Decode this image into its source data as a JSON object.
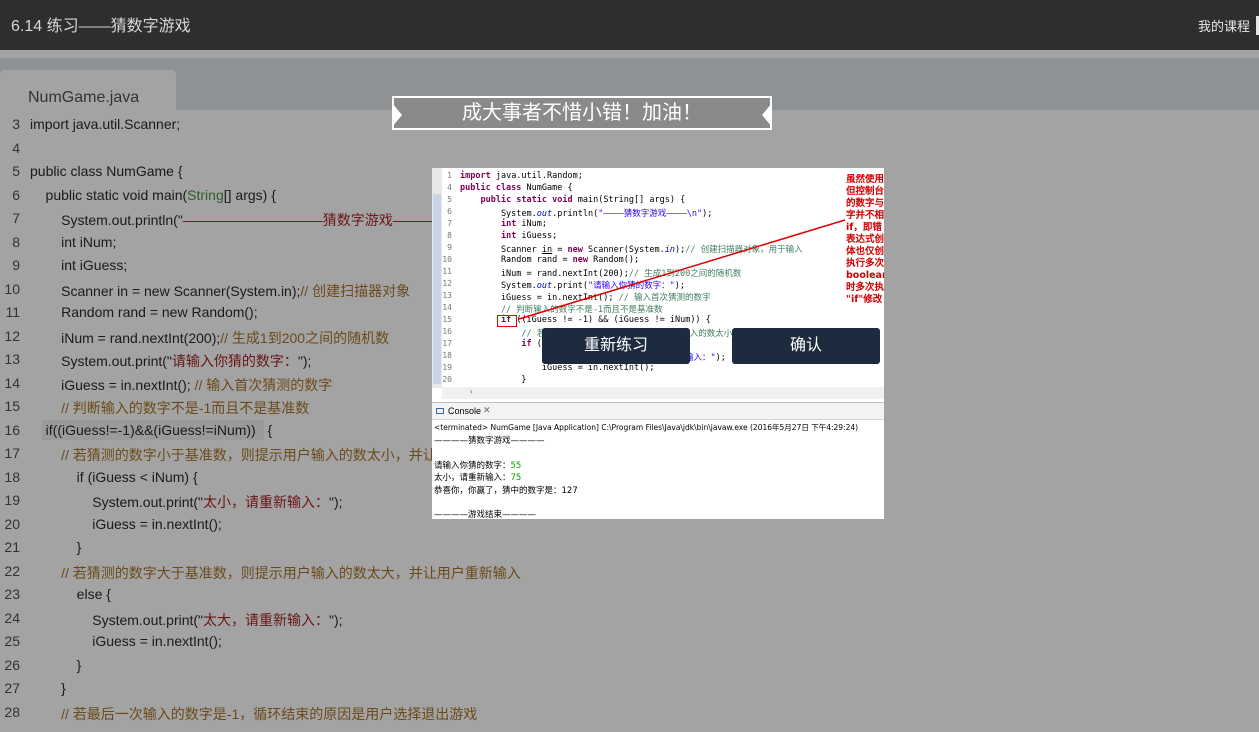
{
  "header": {
    "title": "6.14 练习——猜数字游戏",
    "my_courses": "我的课程"
  },
  "tab": {
    "label": "NumGame.java"
  },
  "editor": {
    "lines": [
      {
        "num": "3",
        "html": "import java.util.Scanner;"
      },
      {
        "num": "4",
        "html": ""
      },
      {
        "num": "5",
        "html": "public class NumGame {"
      },
      {
        "num": "6",
        "html": "    public static void main(<span class=\"ty\">String</span>[] args) {"
      },
      {
        "num": "7",
        "html": "        System.out.println(\"<span class=\"st\">——————————猜数字游戏——————————</span>"
      },
      {
        "num": "8",
        "html": "        int iNum;"
      },
      {
        "num": "9",
        "html": "        int iGuess;"
      },
      {
        "num": "10",
        "html": "        Scanner in = new Scanner(System.in);<span class=\"cm\">// 创建扫描器对象</span>"
      },
      {
        "num": "11",
        "html": "        Random rand = new Random();"
      },
      {
        "num": "12",
        "html": "        iNum = rand.nextInt(200);<span class=\"cm\">// 生成1到200之间的随机数</span>"
      },
      {
        "num": "13",
        "html": "        System.out.print(\"<span class=\"st\">请输入你猜的数字：</span>\");"
      },
      {
        "num": "14",
        "html": "        iGuess = in.nextInt(); <span class=\"cm\">// 输入首次猜测的数字</span>"
      },
      {
        "num": "15",
        "html": "        <span class=\"cm\">// 判断输入的数字不是-1而且不是基准数</span>"
      },
      {
        "num": "16",
        "html": "   <span class=\"hl\">if((iGuess!=-1)&&(iGuess!=iNum)) </span> {"
      },
      {
        "num": "17",
        "html": "        <span class=\"cm\">// 若猜测的数字小于基准数，则提示用户输入的数太小，并让用户重新输入</span>"
      },
      {
        "num": "18",
        "html": "            if (iGuess < iNum) {"
      },
      {
        "num": "19",
        "html": "                System.out.print(\"<span class=\"st\">太小，请重新输入：</span>\");"
      },
      {
        "num": "20",
        "html": "                iGuess = in.nextInt();"
      },
      {
        "num": "21",
        "html": "            }"
      },
      {
        "num": "22",
        "html": "        <span class=\"cm\">// 若猜测的数字大于基准数，则提示用户输入的数太大，并让用户重新输入</span>"
      },
      {
        "num": "23",
        "html": "            else {"
      },
      {
        "num": "24",
        "html": "                System.out.print(\"<span class=\"st\">太大，请重新输入：</span>\");"
      },
      {
        "num": "25",
        "html": "                iGuess = in.nextInt();"
      },
      {
        "num": "26",
        "html": "            }"
      },
      {
        "num": "27",
        "html": "        }"
      },
      {
        "num": "28",
        "html": "        <span class=\"cm\">// 若最后一次输入的数字是-1，循环结束的原因是用户选择退出游戏</span>"
      }
    ]
  },
  "banner": {
    "text": "成大事者不惜小错！加油！"
  },
  "popup": {
    "code_lines": [
      {
        "num": "1",
        "html": "<span class=\"kw\">import</span> java.util.Random;"
      },
      {
        "num": "4",
        "html": "<span class=\"kw\">public class</span> NumGame {"
      },
      {
        "num": "5",
        "html": "    <span class=\"kw\">public static void</span> main(String[] args) {"
      },
      {
        "num": "6",
        "html": "        System.<span class=\"sfld\">out</span>.println(<span class=\"sst\">\"————猜数字游戏————\\n\"</span>);"
      },
      {
        "num": "7",
        "html": "        <span class=\"kw\">int</span> iNum;"
      },
      {
        "num": "8",
        "html": "        <span class=\"kw\">int</span> iGuess;"
      },
      {
        "num": "9",
        "html": "        Scanner <u>in</u> = <span class=\"kw\">new</span> Scanner(System.<span class=\"sfld\">in</span>);<span class=\"scm\">// 创建扫描器对象，用于输入</span>"
      },
      {
        "num": "10",
        "html": "        Random rand = <span class=\"kw\">new</span> Random();"
      },
      {
        "num": "11",
        "html": "        iNum = rand.nextInt(200);<span class=\"scm\">// 生成1到200之间的随机数</span>"
      },
      {
        "num": "12",
        "html": "        System.<span class=\"sfld\">out</span>.print(<span class=\"sst\">\"请输入你猜的数字：\"</span>);"
      },
      {
        "num": "13",
        "html": "        iGuess = in.nextInt(); <span class=\"scm\">// 输入首次猜测的数字</span>"
      },
      {
        "num": "14",
        "html": "        <span class=\"scm\">// 判断输入的数字不是-1而且不是基准数</span>"
      },
      {
        "num": "15",
        "html": "        <span class=\"kw\">if</span> ((iGuess != -1) && (iGuess != iNum)) {"
      },
      {
        "num": "16",
        "html": "            <span class=\"scm\">// 若猜测的数字小于基准数，则提示用户输入的数太小，并让</span>"
      },
      {
        "num": "17",
        "html": "            <span class=\"kw\">if</span> (iGuess < iNum) {"
      },
      {
        "num": "18",
        "html": "                System.<span class=\"sfld\">out</span>.print(<span class=\"sst\">\"太小，请重新输入：\"</span>);"
      },
      {
        "num": "19",
        "html": "                iGuess = in.nextInt();"
      },
      {
        "num": "20",
        "html": "            }"
      }
    ],
    "console_tab": "Console",
    "console_lines": [
      "<terminated> NumGame [Java Application] C:\\Program Files\\Java\\jdk\\bin\\javaw.exe (2016年5月27日 下午4:29:24)",
      "————猜数字游戏————",
      "",
      "请输入你猜的数字：<span class=\"green\">55</span>",
      "太小，请重新输入：<span class=\"green\">75</span>",
      "恭喜你，你赢了，猜中的数字是：127",
      "",
      "————游戏结束————"
    ],
    "annotation": "虽然使用\n但控制台\n的数字与\n字并不相\nif，即错\n表达式创\n体也仅创\n执行多次\nboolean\n时多次执\n\"if\"修改"
  },
  "buttons": {
    "retry": "重新练习",
    "confirm": "确认"
  },
  "colors": {
    "topbar": "#2e2e2e",
    "button": "#1c2b3e",
    "annotation": "#d00000"
  }
}
